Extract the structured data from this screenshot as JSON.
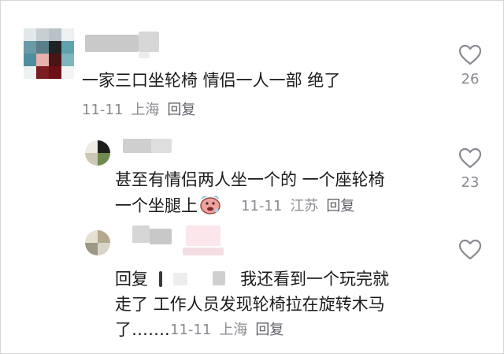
{
  "comments": [
    {
      "text": "一家三口坐轮椅 情侣一人一部 绝了",
      "date": "11-11",
      "location": "上海",
      "reply": "回复",
      "likes": "26"
    },
    {
      "lines": [
        "甚至有情侣两人坐一个的 一个座轮椅",
        "一个坐腿上"
      ],
      "date": "11-11",
      "location": "江苏",
      "reply": "回复",
      "likes": "23",
      "emoji": "face-with-steam-emoji"
    },
    {
      "reply_prefix": "回复",
      "lines": [
        "我还看到一个玩完就",
        "走了 工作人员发现轮椅拉在旋转木马",
        "了……."
      ],
      "date": "11-11",
      "location": "上海",
      "reply": "回复",
      "likes": ""
    }
  ],
  "colors": {
    "text": "#1a1a1a",
    "meta": "#8a8b91",
    "heart": "#8a8b91"
  }
}
